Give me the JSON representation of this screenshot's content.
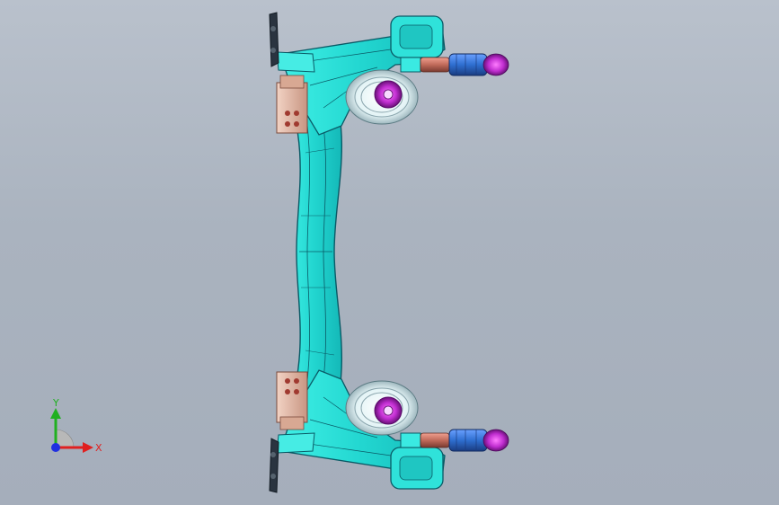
{
  "viewport": {
    "background_top": "#b9c1cc",
    "background_bottom": "#a5aebb"
  },
  "model": {
    "description_color_frame": "#33e0d8",
    "description_color_outline": "#0a5a66",
    "color_hub_magenta": "#c030d0",
    "color_shock_blue": "#2f6fd0",
    "color_shock_red": "#c06a5a",
    "color_bracket_tan": "#e0b8a8",
    "color_dark_link": "#2a3440"
  },
  "triad": {
    "x_label": "X",
    "y_label": "Y",
    "x_color": "#e02020",
    "y_color": "#20b020",
    "z_color": "#2030e0"
  }
}
